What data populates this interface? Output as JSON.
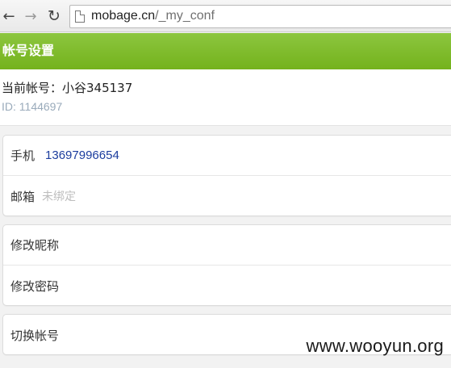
{
  "browser": {
    "back_icon": "back-arrow-icon",
    "forward_icon": "forward-arrow-icon",
    "reload_icon": "reload-icon",
    "url_host": "mobage.cn",
    "url_path": "/_my_conf"
  },
  "header": {
    "title": "帐号设置",
    "color_top": "#8cc63f",
    "color_bottom": "#74b21c"
  },
  "account": {
    "current_label": "当前帐号：小谷345137",
    "id_text": "ID: 1144697"
  },
  "contact": {
    "phone_label": "手机",
    "phone_value": "13697996654",
    "email_label": "邮箱",
    "email_value": "未绑定"
  },
  "settings": {
    "nickname_label": "修改昵称",
    "password_label": "修改密码"
  },
  "switch": {
    "switch_label": "切换帐号"
  },
  "watermark": "www.wooyun.org"
}
